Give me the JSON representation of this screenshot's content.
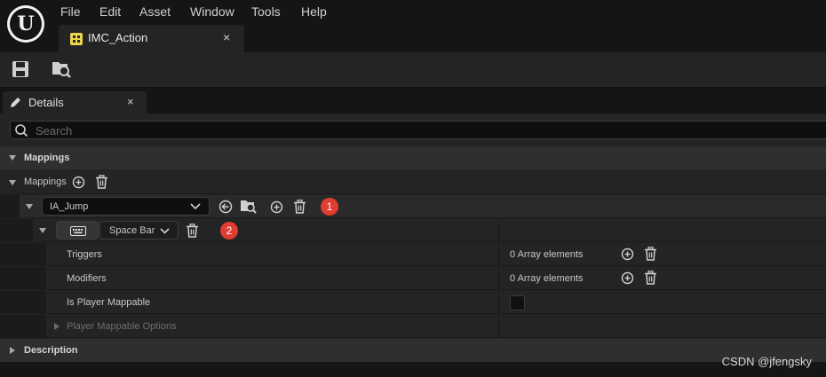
{
  "menu": {
    "items": [
      {
        "label": "File"
      },
      {
        "label": "Edit"
      },
      {
        "label": "Asset"
      },
      {
        "label": "Window"
      },
      {
        "label": "Tools"
      },
      {
        "label": "Help"
      }
    ]
  },
  "asset_tab": {
    "label": "IMC_Action",
    "close": "×"
  },
  "details_tab": {
    "label": "Details",
    "close": "×"
  },
  "search": {
    "placeholder": "Search"
  },
  "sections": {
    "mappings_category": "Mappings",
    "mappings_row": "Mappings",
    "description_category": "Description"
  },
  "mapping": {
    "action_value": "IA_Jump",
    "action_badge": "1",
    "key_value": "Space Bar",
    "key_badge": "2",
    "properties": [
      {
        "label": "Triggers",
        "value": "0 Array elements"
      },
      {
        "label": "Modifiers",
        "value": "0 Array elements"
      },
      {
        "label": "Is Player Mappable",
        "value": ""
      },
      {
        "label": "Player Mappable Options",
        "value": ""
      }
    ],
    "is_player_mappable_checked": false
  },
  "watermark": "CSDN @jfengsky",
  "colors": {
    "background": "#151515",
    "panel": "#242424",
    "badge": "#e03c31"
  }
}
